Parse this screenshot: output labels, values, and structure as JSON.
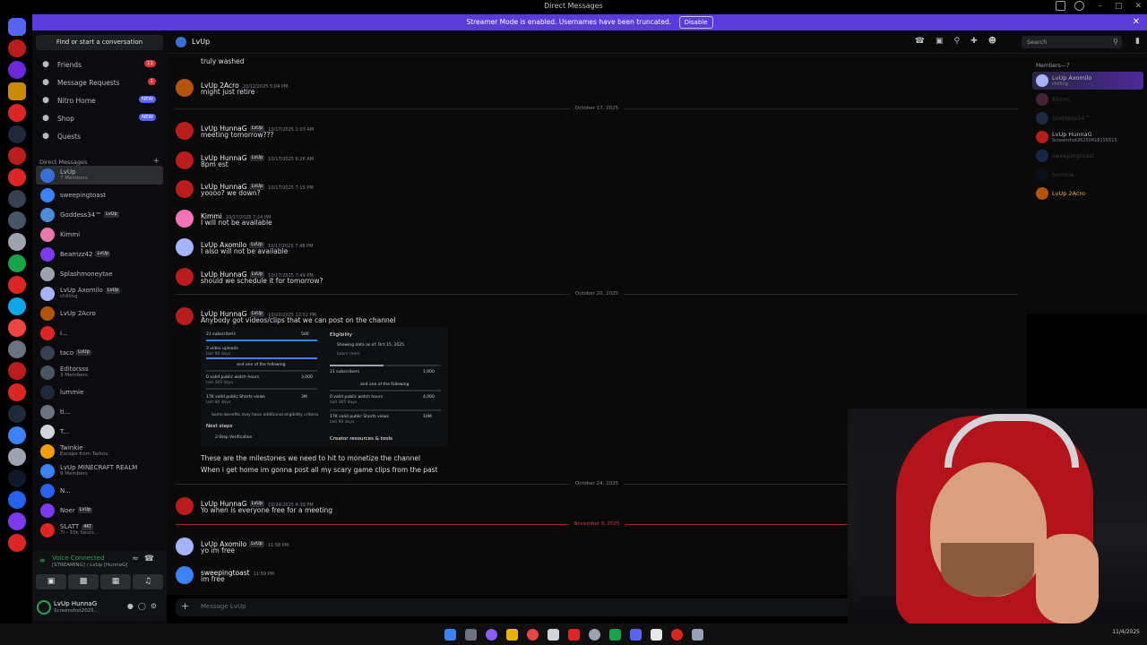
{
  "window": {
    "title": "Direct Messages"
  },
  "banner": {
    "text": "Streamer Mode is enabled. Usernames have been truncated.",
    "disable_label": "Disable"
  },
  "sidebar": {
    "search_label": "Find or start a conversation",
    "nav": [
      {
        "label": "Friends",
        "badge": "11",
        "icon": "friends-icon"
      },
      {
        "label": "Message Requests",
        "badge": "1",
        "icon": "message-requests-icon"
      },
      {
        "label": "Nitro Home",
        "badge": "NEW",
        "icon": "nitro-icon"
      },
      {
        "label": "Shop",
        "badge": "NEW",
        "icon": "shop-icon"
      },
      {
        "label": "Quests",
        "badge": "",
        "icon": "quests-icon"
      }
    ],
    "dm_header": "Direct Messages",
    "dms": [
      {
        "name": "LvUp",
        "sub": "7 Members",
        "tag": "",
        "color": "#3b6fd8"
      },
      {
        "name": "sweepingtoast",
        "sub": "",
        "tag": "",
        "color": "#3b82f6"
      },
      {
        "name": "Goddess34™",
        "sub": "",
        "tag": "LvUp",
        "color": "#4b8bd8"
      },
      {
        "name": "Kimmi",
        "sub": "",
        "tag": "",
        "color": "#e879a8"
      },
      {
        "name": "Beamzz42",
        "sub": "",
        "tag": "LvUp",
        "color": "#7c3aed"
      },
      {
        "name": "Splashmoneytae",
        "sub": "",
        "tag": "",
        "color": "#9ca3af"
      },
      {
        "name": "LvUp Axomilo",
        "sub": "chilling",
        "tag": "LvUp",
        "color": "#a5b4fc"
      },
      {
        "name": "LvUp 2Acro",
        "sub": "",
        "tag": "",
        "color": "#b45309"
      },
      {
        "name": "i...",
        "sub": "",
        "tag": "",
        "color": "#dc2626"
      },
      {
        "name": "taco",
        "sub": "",
        "tag": "LvUp",
        "color": "#374151"
      },
      {
        "name": "Editorsss",
        "sub": "3 Members",
        "tag": "",
        "color": "#4b5563"
      },
      {
        "name": "lummie",
        "sub": "",
        "tag": "",
        "color": "#1f2937"
      },
      {
        "name": "ti...",
        "sub": "",
        "tag": "",
        "color": "#6b7280"
      },
      {
        "name": "T...",
        "sub": "",
        "tag": "",
        "color": "#d1d5db"
      },
      {
        "name": "Twinkie",
        "sub": "Escape from Tarkov",
        "tag": "",
        "color": "#f59e0b"
      },
      {
        "name": "LvUp MINECRAFT REALM",
        "sub": "9 Members",
        "tag": "",
        "color": "#3b82f6"
      },
      {
        "name": "N...",
        "sub": "",
        "tag": "",
        "color": "#2563eb"
      },
      {
        "name": "Noer",
        "sub": "",
        "tag": "LvUp",
        "color": "#7c3aed"
      },
      {
        "name": "SLATT",
        "sub": "7l - 10k hours...",
        "tag": "4KT",
        "color": "#dc2626"
      }
    ],
    "voice": {
      "status": "Voice Connected",
      "channel": "[STREAMING] / LvUp [HunnaG]"
    },
    "user": {
      "name": "LvUp HunnaG",
      "status": "Screenshot2025..."
    }
  },
  "chat": {
    "channel_name": "LvUp",
    "search_placeholder": "Search",
    "composer_placeholder": "Message LvUp",
    "messages": [
      {
        "author": "",
        "time": "",
        "text": "truly washed",
        "avatar": ""
      },
      {
        "author": "LvUp 2Acro",
        "time": "10/12/2025 5:04 PM",
        "text": "might just retire",
        "avatar": "#b45309",
        "tag": false
      },
      {
        "author": "LvUp HunnaG",
        "time": "10/17/2025 1:03 AM",
        "text": "meeting tomorrow???",
        "avatar": "#b91c1c",
        "tag": true
      },
      {
        "author": "LvUp HunnaG",
        "time": "10/17/2025 6:26 AM",
        "text": "8pm est",
        "avatar": "#b91c1c",
        "tag": true
      },
      {
        "author": "LvUp HunnaG",
        "time": "10/17/2025 7:15 PM",
        "text": "yoooo? we down?",
        "avatar": "#b91c1c",
        "tag": true
      },
      {
        "author": "Kimmi",
        "time": "10/17/2025 7:24 PM",
        "text": "I will not be available",
        "avatar": "#f472b6",
        "tag": false
      },
      {
        "author": "LvUp Axomilo",
        "time": "10/17/2025 7:48 PM",
        "text": "I also will not be available",
        "avatar": "#a5b4fc",
        "tag": true
      },
      {
        "author": "LvUp HunnaG",
        "time": "10/17/2025 7:49 PM",
        "text": "should we schedule it for tomorrow?",
        "avatar": "#b91c1c",
        "tag": true
      },
      {
        "author": "LvUp HunnaG",
        "time": "10/20/2025 12:52 PM",
        "text": "Anybody got videos/clips that we can post on the channel",
        "avatar": "#b91c1c",
        "tag": true
      },
      {
        "author": "LvUp HunnaG",
        "time": "10/24/2025 4:39 PM",
        "text": "Yo when is everyone free for a meeting",
        "avatar": "#b91c1c",
        "tag": true
      },
      {
        "author": "LvUp Axomilo",
        "time": "11:58 PM",
        "text": "yo im free",
        "avatar": "#a5b4fc",
        "tag": true
      },
      {
        "author": "sweepingtoast",
        "time": "11:59 PM",
        "text": "im free",
        "avatar": "#3b82f6",
        "tag": false
      }
    ],
    "followups": [
      "These are the milestones we need to hit to monetize the channel",
      "When i get home im gonna post all my scary game clips from the past"
    ],
    "dividers": [
      "October 17, 2025",
      "October 20, 2025",
      "October 24, 2025",
      "November 3, 2025"
    ],
    "tag_label": "LvUp",
    "attachment": {
      "left": {
        "subscribers": "21 subscribers",
        "subscribers_target": "500",
        "uploads": "3 video uploads",
        "uploads_sub": "last 90 days",
        "one_of": "and one of the following",
        "watch_hours": "0 valid public watch hours",
        "watch_sub": "last 365 days",
        "watch_target": "3,000",
        "shorts": "17K valid public Shorts views",
        "shorts_sub": "last 90 days",
        "shorts_target": "3M",
        "note": "Some benefits may have additional eligibility criteria",
        "next_steps": "Next steps",
        "verification": "2-Step Verification"
      },
      "right": {
        "title": "Eligibility",
        "showing": "Showing data as of: Oct 15, 2025",
        "learn": "Learn more",
        "subscribers": "21 subscribers",
        "subscribers_target": "1,000",
        "one_of": "and one of the following",
        "watch_hours": "0 valid public watch hours",
        "watch_sub": "last 365 days",
        "watch_target": "4,000",
        "shorts": "17K valid public Shorts views",
        "shorts_sub": "last 90 days",
        "shorts_target": "10M",
        "resources": "Creator resources & tools"
      }
    }
  },
  "members": {
    "header": "Members—7",
    "list": [
      {
        "name": "LvUp Axomilo",
        "sub": "chilling",
        "color": "#a5b4fc",
        "dim": false,
        "highlight": true
      },
      {
        "name": "Kimmi",
        "sub": "",
        "color": "#f472b6",
        "dim": true,
        "highlight": false
      },
      {
        "name": "Goddess34™",
        "sub": "",
        "color": "#4b8bd8",
        "dim": true,
        "highlight": false
      },
      {
        "name": "LvUp HunnaG",
        "sub": "Screenshot20250418155515",
        "color": "#b91c1c",
        "dim": false,
        "highlight": false
      },
      {
        "name": "sweepingtoast",
        "sub": "",
        "color": "#3b82f6",
        "dim": true,
        "highlight": false
      },
      {
        "name": "lummie",
        "sub": "",
        "color": "#1f2937",
        "dim": true,
        "highlight": false
      },
      {
        "name": "LvUp 2Acro",
        "sub": "",
        "color": "#b45309",
        "dim": false,
        "highlight": false
      }
    ]
  },
  "taskbar": {
    "date": "11/4/2025"
  }
}
